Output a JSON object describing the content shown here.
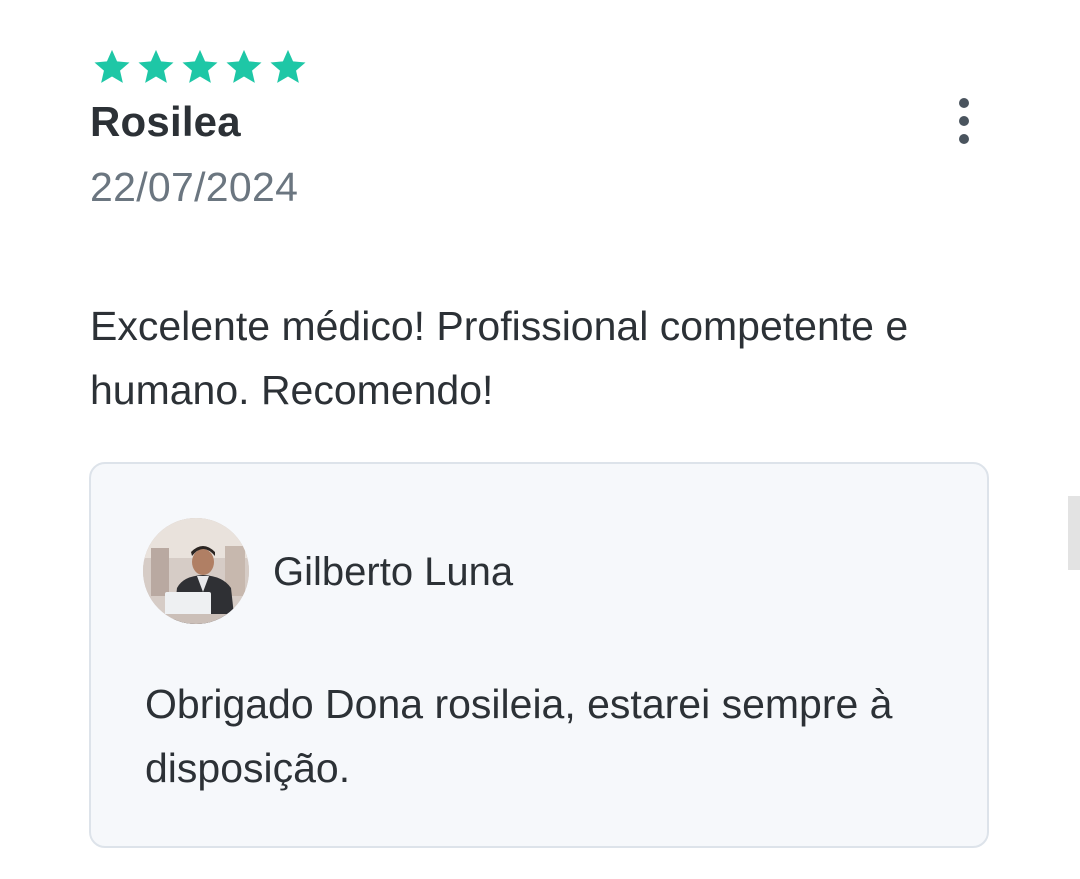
{
  "review": {
    "rating": 5,
    "rating_max": 5,
    "star_color": "#1ec7a6",
    "reviewer_name": "Rosilea",
    "date": "22/07/2024",
    "text": "Excelente médico! Profissional competente e humano. Recomendo!",
    "more_icon": "more-vertical-icon"
  },
  "reply": {
    "responder_name": "Gilberto Luna",
    "avatar_icon": "profile-photo",
    "text": "Obrigado Dona rosileia, estarei sempre à disposição."
  }
}
